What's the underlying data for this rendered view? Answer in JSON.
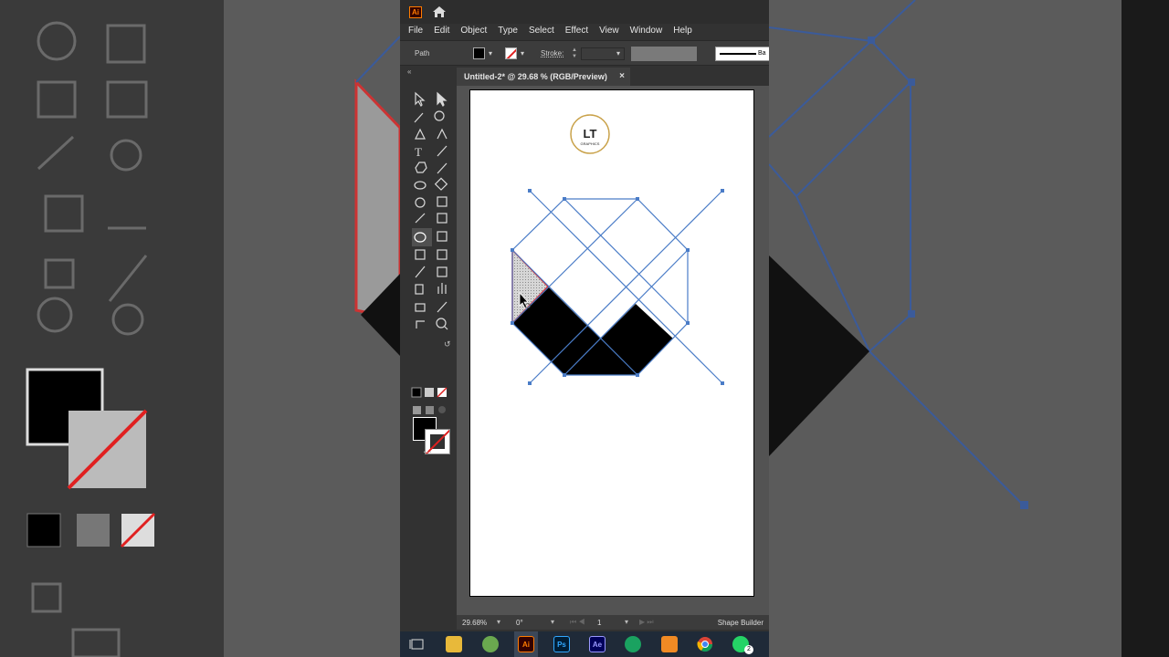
{
  "titlebar": {
    "app_badge": "Ai"
  },
  "menu": [
    "File",
    "Edit",
    "Object",
    "Type",
    "Select",
    "Effect",
    "View",
    "Window",
    "Help"
  ],
  "control": {
    "selection_label": "Path",
    "stroke_label": "Stroke:",
    "brush_label": "Ba"
  },
  "document": {
    "tab_title": "Untitled-2* @ 29.68 % (RGB/Preview)",
    "close": "×"
  },
  "logo": {
    "text": "LT",
    "subtext": "GRAPHICS"
  },
  "status": {
    "zoom": "29.68%",
    "angle": "0°",
    "page": "1",
    "tool": "Shape Builder"
  },
  "toolbar": {
    "more": "..."
  },
  "taskbar": {
    "apps": [
      "task-view",
      "file-explorer",
      "paint",
      "illustrator",
      "photoshop",
      "after-effects",
      "edge-app",
      "app-orange",
      "chrome",
      "whatsapp"
    ],
    "labels": {
      "ai": "Ai",
      "ps": "Ps",
      "ae": "Ae",
      "whatsapp_badge": "2"
    }
  },
  "colors": {
    "accent": "#ff7c00",
    "path_blue": "#4a7cc7",
    "selection_red": "#e02020",
    "canvas": "#535353"
  }
}
